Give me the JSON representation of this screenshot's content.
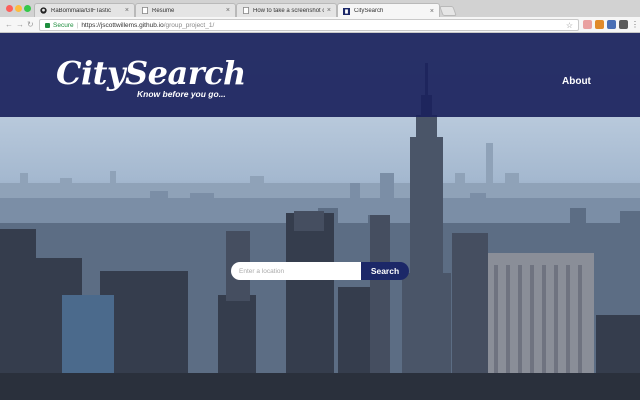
{
  "browser": {
    "tabs": [
      {
        "label": "RaBommala/GIFTastic",
        "icon": "github-icon",
        "active": false
      },
      {
        "label": "Resume",
        "icon": "document-icon",
        "active": false
      },
      {
        "label": "How to take a screenshot on y",
        "icon": "page-icon",
        "active": false
      },
      {
        "label": "CitySearch",
        "icon": "site-favicon-icon",
        "active": true
      }
    ],
    "secure_label": "Secure",
    "separator": "|",
    "url_host": "https://jscottwillems.github.io",
    "url_path": "/group_project_1/"
  },
  "header": {
    "brand": "CitySearch",
    "tagline": "Know before you go...",
    "about_label": "About"
  },
  "search": {
    "placeholder": "Enter a location",
    "value": "",
    "button_label": "Search"
  },
  "colors": {
    "header_bg": "#1a225c",
    "search_button": "#1c2868",
    "secure_green": "#1e8e3e"
  }
}
